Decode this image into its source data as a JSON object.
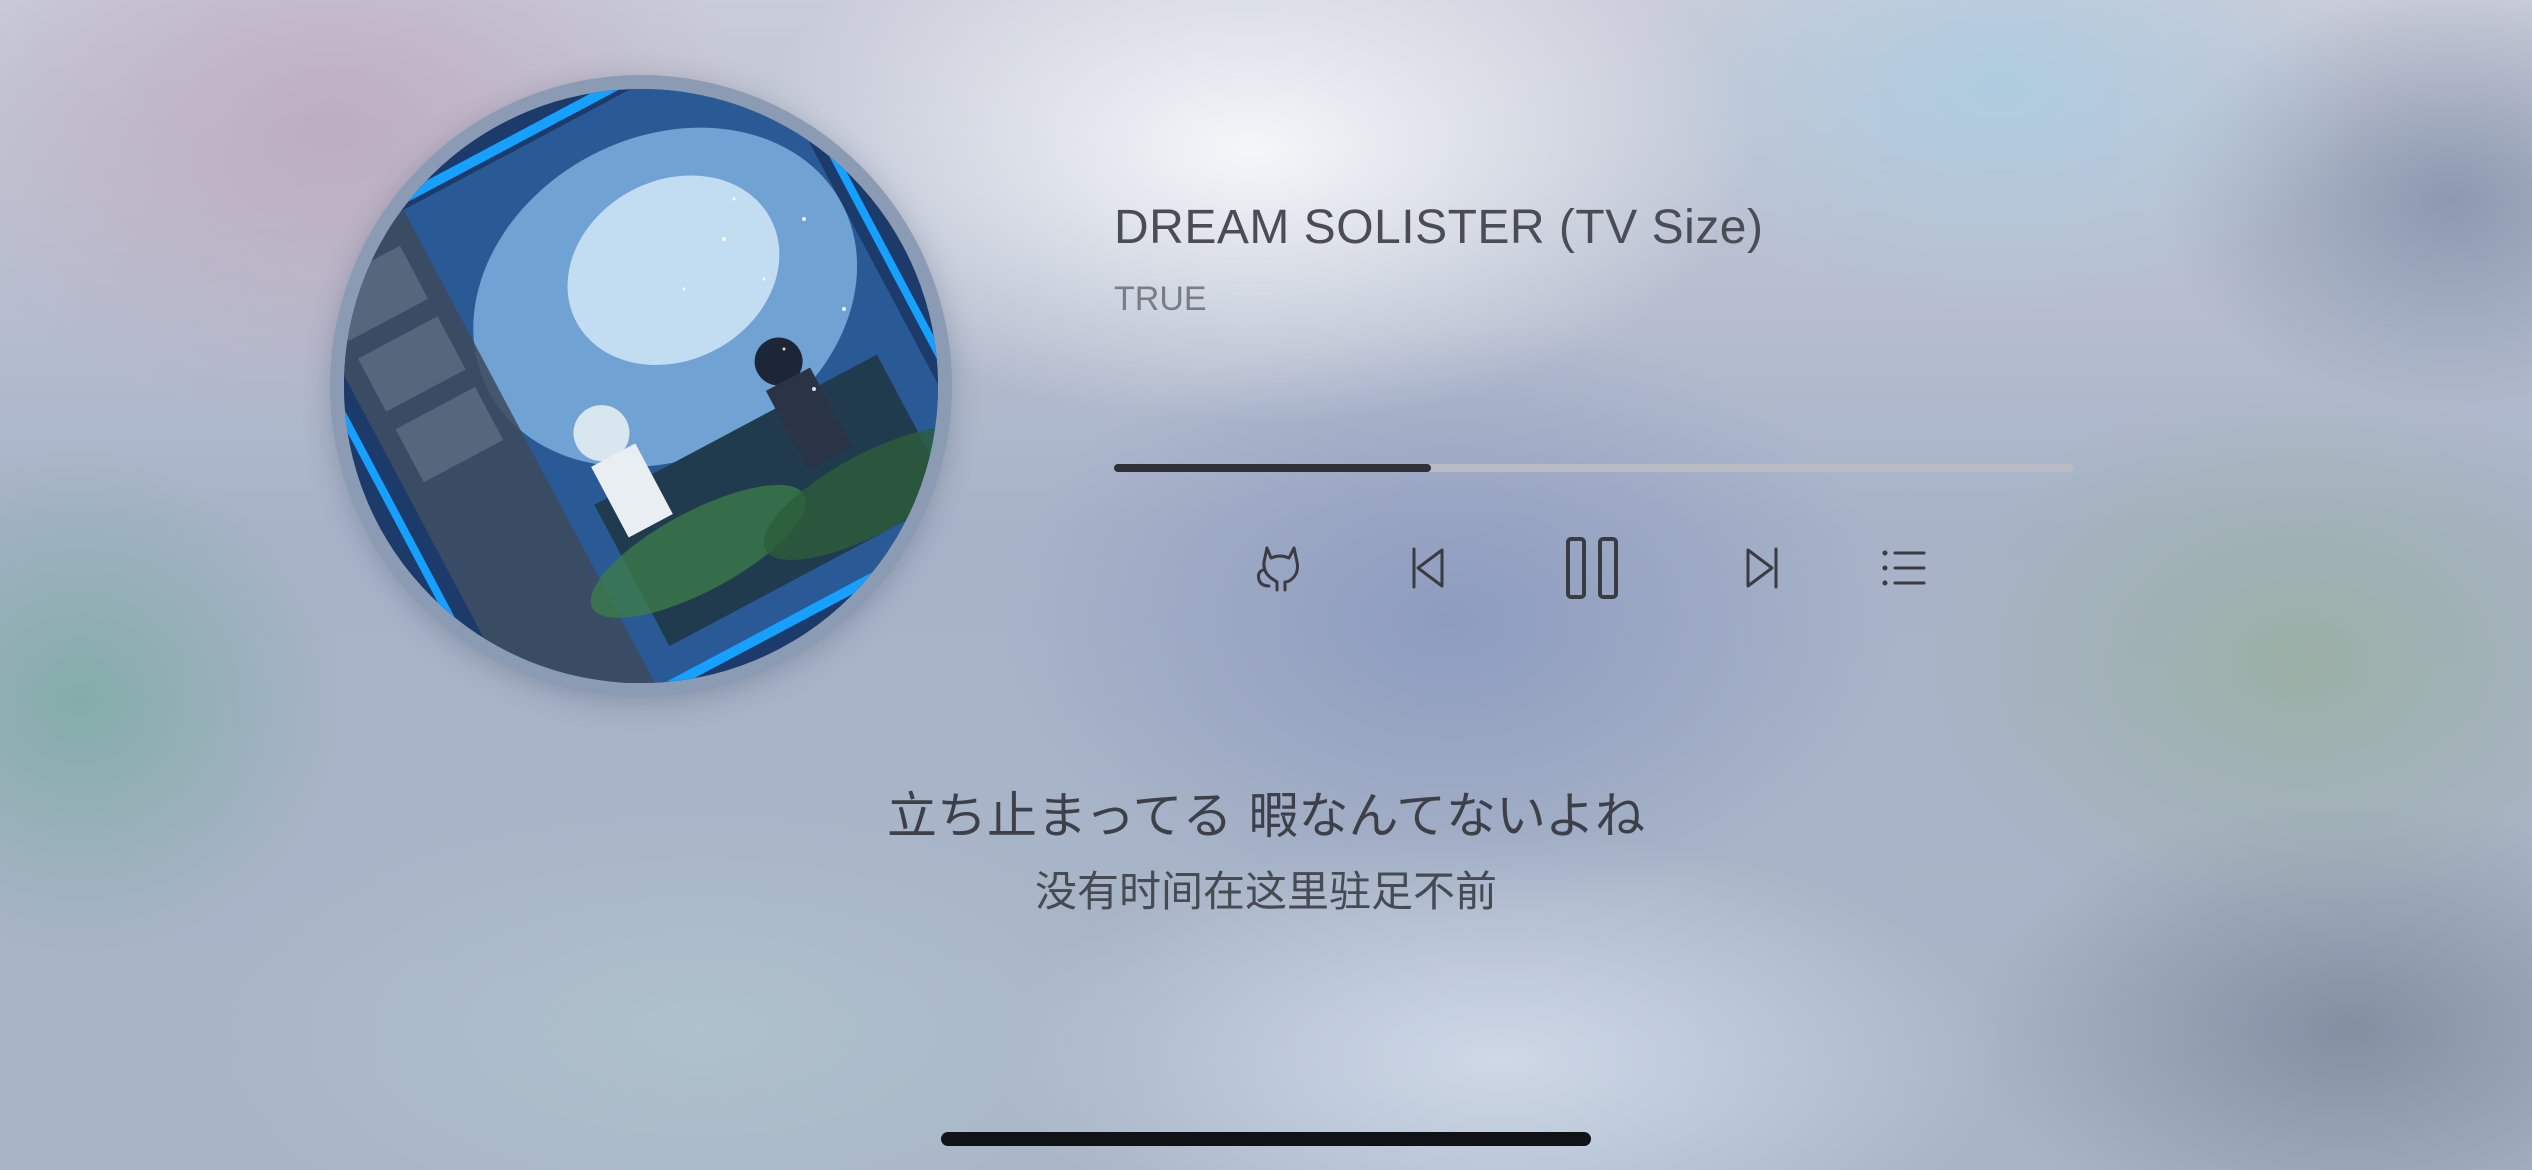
{
  "track": {
    "title": "DREAM SOLISTER (TV Size)",
    "artist": "TRUE"
  },
  "progress": {
    "fraction": 0.33
  },
  "controls": {
    "mode_icon": "cat-icon",
    "prev_icon": "skip-previous-icon",
    "play_pause_icon": "pause-icon",
    "next_icon": "skip-next-icon",
    "playlist_icon": "playlist-icon"
  },
  "lyrics": {
    "current_line": "立ち止まってる 暇なんてないよね",
    "translation": "没有时间在这里驻足不前"
  },
  "colors": {
    "progress_played": "#2f3136",
    "progress_track": "#b9bcc4",
    "text_primary": "#4a4d55"
  }
}
